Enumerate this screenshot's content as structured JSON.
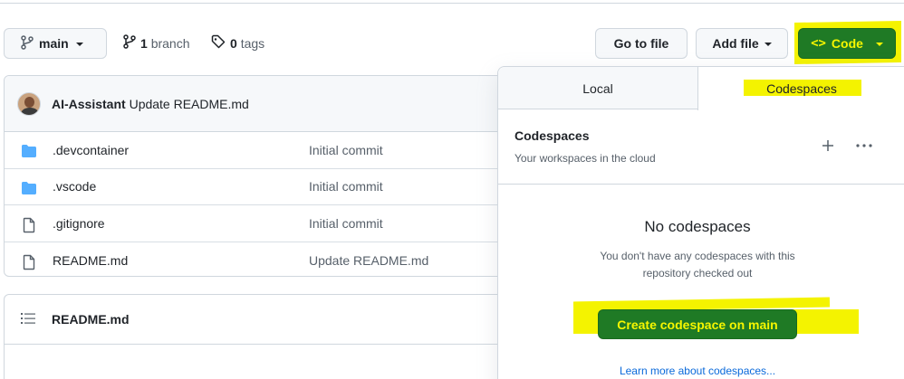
{
  "toolbar": {
    "branch_label": "main",
    "branch_count": "1",
    "branch_text": "branch",
    "tag_count": "0",
    "tag_text": "tags",
    "goto_file_label": "Go to file",
    "add_file_label": "Add file",
    "code_label": "Code"
  },
  "latest_commit": {
    "author": "AI-Assistant",
    "message": "Update README.md"
  },
  "files": [
    {
      "name": ".devcontainer",
      "type": "folder",
      "commit": "Initial commit"
    },
    {
      "name": ".vscode",
      "type": "folder",
      "commit": "Initial commit"
    },
    {
      "name": ".gitignore",
      "type": "file",
      "commit": "Initial commit"
    },
    {
      "name": "README.md",
      "type": "file",
      "commit": "Update README.md"
    }
  ],
  "readme": {
    "title": "README.md"
  },
  "code_panel": {
    "tabs": [
      "Local",
      "Codespaces"
    ],
    "active_tab": "Codespaces",
    "title": "Codespaces",
    "subtitle": "Your workspaces in the cloud",
    "empty_title": "No codespaces",
    "empty_desc": "You don't have any codespaces with this repository checked out",
    "create_label": "Create codespace on main",
    "learn_more": "Learn more about codespaces..."
  },
  "colors": {
    "accent_green": "#1f7a25",
    "highlight_yellow": "#f4f300",
    "link_blue": "#0969da",
    "folder_blue": "#54aeff"
  },
  "icons": {
    "branch": "git-branch-icon",
    "tag": "tag-icon",
    "code": "code-icon",
    "folder": "folder-icon",
    "file": "file-icon",
    "list": "list-icon",
    "plus": "plus-icon",
    "more": "kebab-horizontal-icon"
  }
}
